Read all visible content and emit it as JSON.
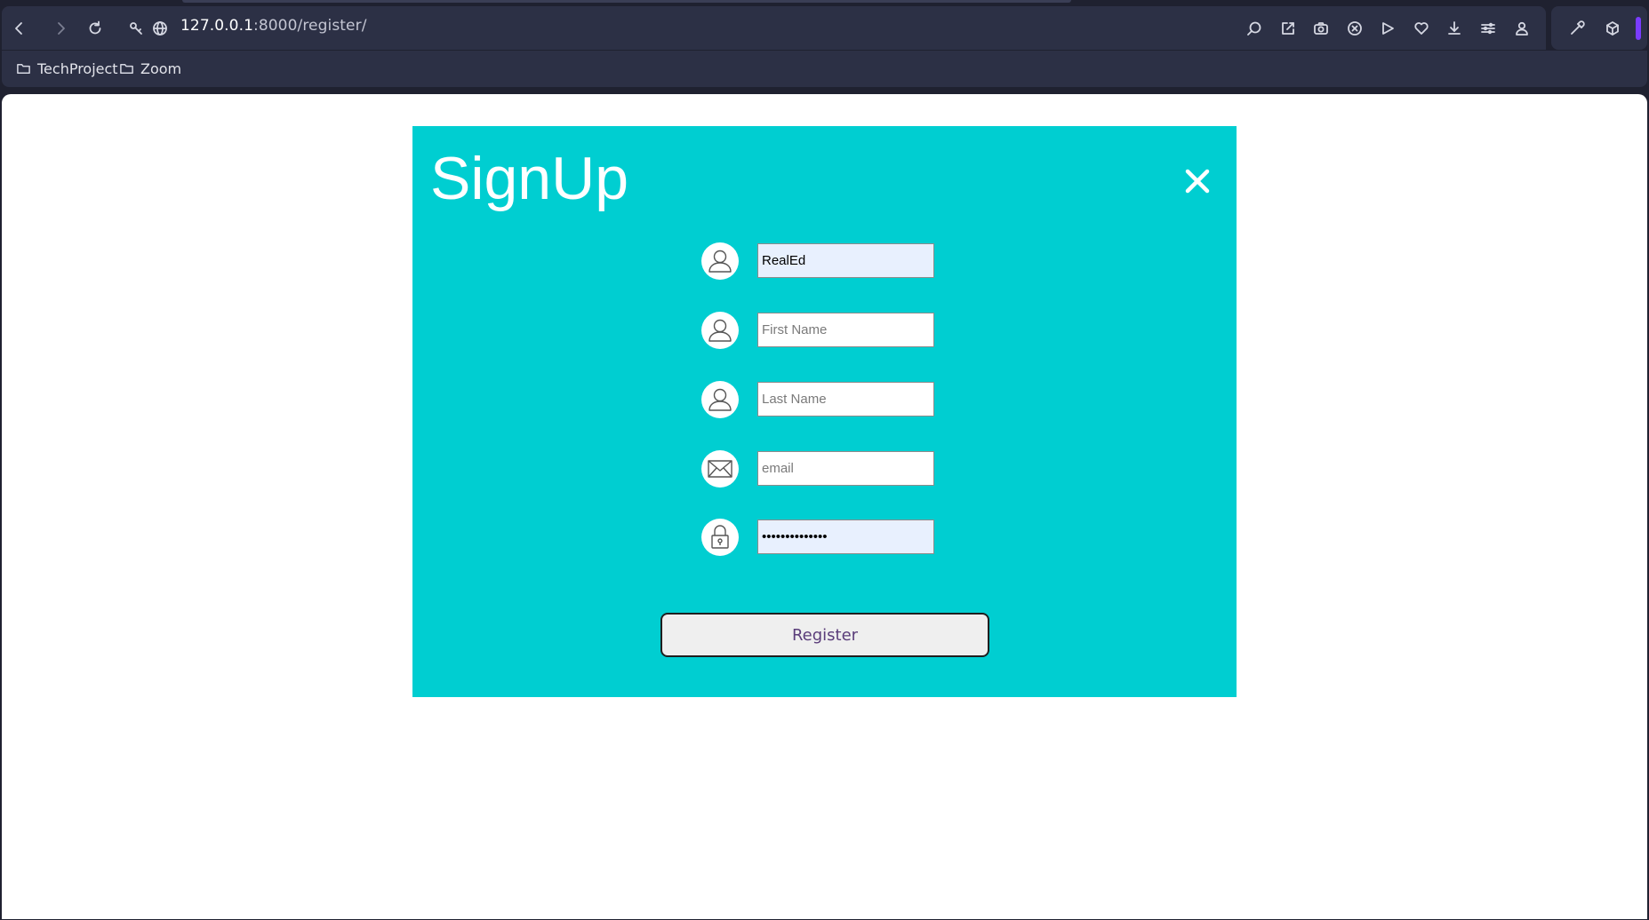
{
  "browser": {
    "url_host": "127.0.0.1",
    "url_path": ":8000/register/",
    "toolbar_icons": [
      "back-icon",
      "forward-icon",
      "reload-icon",
      "site-settings-icon",
      "globe-icon",
      "zoom-search-icon",
      "edit-share-icon",
      "camera-icon",
      "block-icon",
      "send-icon",
      "heart-icon",
      "download-icon",
      "tab-settings-icon",
      "profile-icon",
      "eyedropper-icon",
      "cube-icon"
    ],
    "bookmarks": [
      {
        "label": "TechProject",
        "icon": "folder-icon"
      },
      {
        "label": "Zoom",
        "icon": "folder-icon"
      }
    ]
  },
  "colors": {
    "panel": "#00CED1",
    "accent": "#7A3CFF"
  },
  "form": {
    "title": "SignUp",
    "close_icon": "close-icon",
    "fields": [
      {
        "name": "username",
        "icon": "user-icon",
        "value": "RealEd",
        "placeholder": ""
      },
      {
        "name": "first-name",
        "icon": "user-icon",
        "value": "",
        "placeholder": "First Name"
      },
      {
        "name": "last-name",
        "icon": "user-icon",
        "value": "",
        "placeholder": "Last Name"
      },
      {
        "name": "email",
        "icon": "envelope-icon",
        "value": "",
        "placeholder": "email"
      },
      {
        "name": "password",
        "icon": "lock-icon",
        "value": "realed12345678",
        "placeholder": ""
      }
    ],
    "submit_label": "Register"
  }
}
